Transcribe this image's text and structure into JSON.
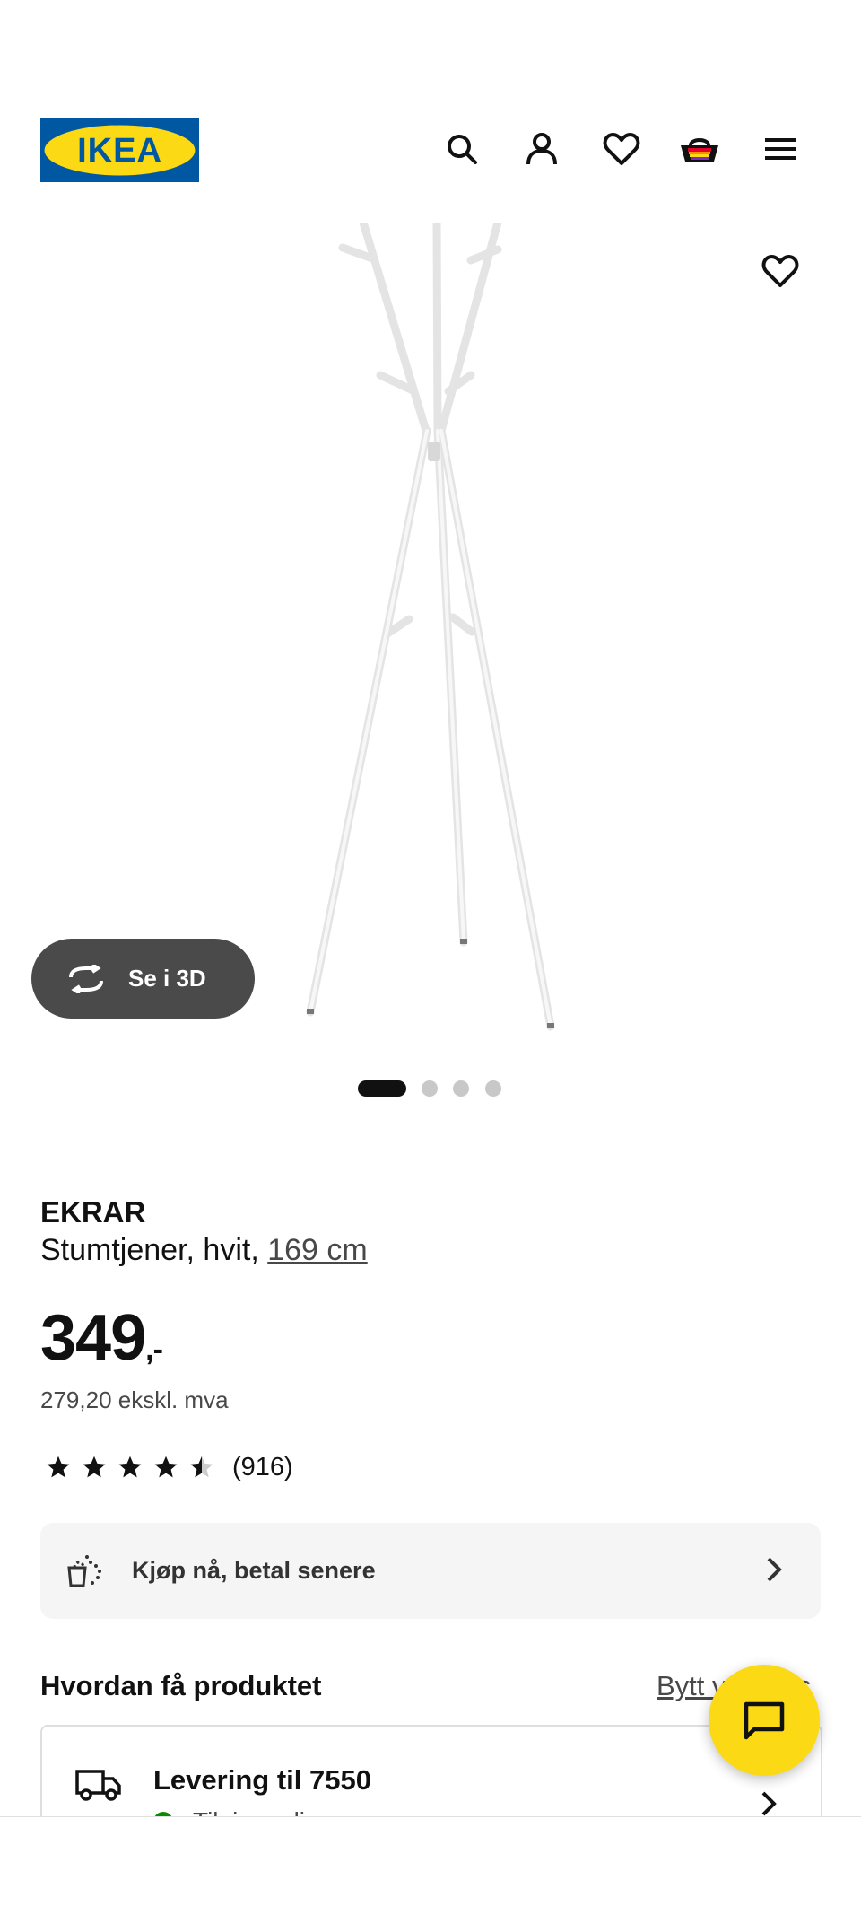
{
  "header": {
    "logo_text": "IKEA",
    "icons": [
      "search-icon",
      "account-icon",
      "heart-icon",
      "basket-icon",
      "menu-icon"
    ]
  },
  "gallery": {
    "view_3d_label": "Se i 3D",
    "slide_count": 4,
    "active_slide": 1
  },
  "product": {
    "name": "EKRAR",
    "description_prefix": "Stumtjener, hvit, ",
    "size_link": "169 cm",
    "price_main": "349",
    "price_suffix": ",-",
    "price_ex_vat": "279,20 ekskl. mva",
    "rating_value": 4.5,
    "rating_count": "(916)"
  },
  "bnpl": {
    "label": "Kjøp nå, betal senere"
  },
  "how_to_get": {
    "title": "Hvordan få produktet",
    "change_link": "Bytt varehus",
    "delivery_title": "Levering til 7550",
    "delivery_status": "Tilgjengelig"
  },
  "colors": {
    "ikea_blue": "#0058a3",
    "ikea_yellow": "#fbd914",
    "available_green": "#0a8a00"
  }
}
